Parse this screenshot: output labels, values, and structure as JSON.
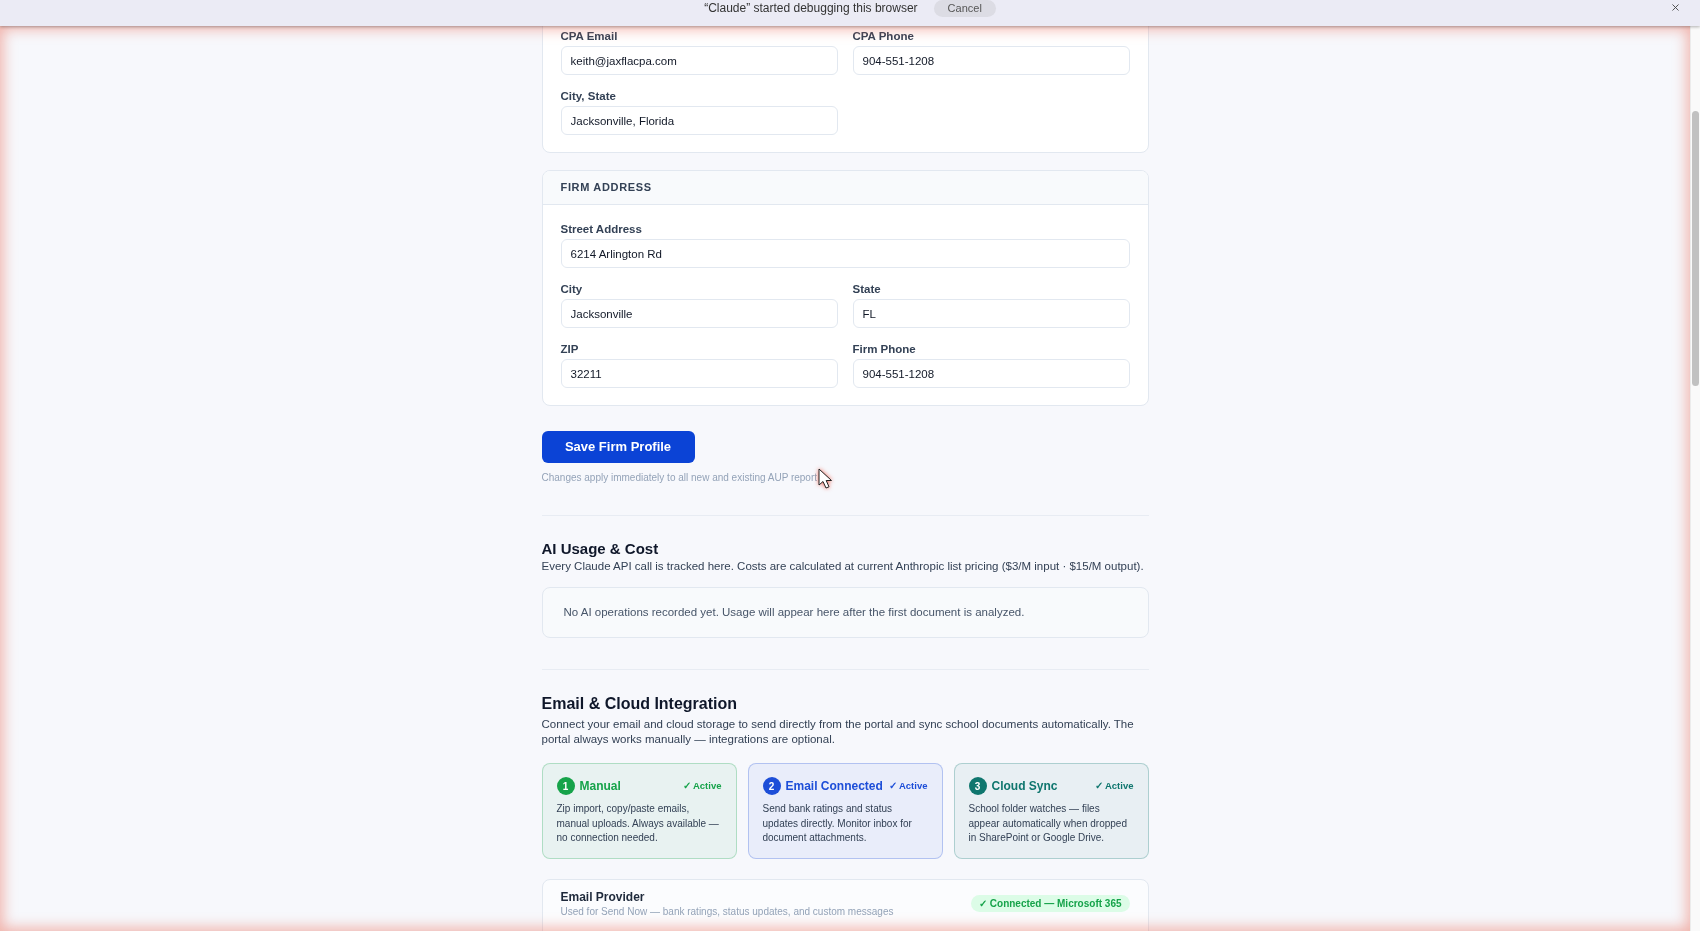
{
  "debug_banner": {
    "message": "“Claude” started debugging this browser",
    "cancel_button": "Cancel"
  },
  "cpa_details": {
    "fields": [
      {
        "label": "CPA Email",
        "value": "keith@jaxflacpa.com"
      },
      {
        "label": "CPA Phone",
        "value": "904-551-1208"
      },
      {
        "label": "City, State",
        "value": "Jacksonville, Florida"
      }
    ]
  },
  "firm_address": {
    "title": "FIRM ADDRESS",
    "street": {
      "label": "Street Address",
      "value": "6214 Arlington Rd"
    },
    "fields": [
      {
        "label": "City",
        "value": "Jacksonville"
      },
      {
        "label": "State",
        "value": "FL"
      },
      {
        "label": "ZIP",
        "value": "32211"
      },
      {
        "label": "Firm Phone",
        "value": "904-551-1208"
      }
    ]
  },
  "save_button": "Save Firm Profile",
  "save_note": "Changes apply immediately to all new and existing AUP report",
  "ai_usage": {
    "title": "AI Usage & Cost",
    "description": "Every Claude API call is tracked here. Costs are calculated at current Anthropic list pricing ($3/M input · $15/M output).",
    "empty_message": "No AI operations recorded yet. Usage will appear here after the first document is analyzed."
  },
  "integration": {
    "title": "Email & Cloud Integration",
    "description": "Connect your email and cloud storage to send directly from the portal and sync school documents automatically. The portal always works manually — integrations are optional.",
    "modes": [
      {
        "number": "1",
        "name": "Manual",
        "status": "✓ Active",
        "description": "Zip import, copy/paste emails, manual uploads. Always available — no connection needed.",
        "color": "#16a34a"
      },
      {
        "number": "2",
        "name": "Email Connected",
        "status": "✓ Active",
        "description": "Send bank ratings and status updates directly. Monitor inbox for document attachments.",
        "color": "#1d4ed8"
      },
      {
        "number": "3",
        "name": "Cloud Sync",
        "status": "✓ Active",
        "description": "School folder watches — files appear automatically when dropped in SharePoint or Google Drive.",
        "color": "#0f766e"
      }
    ],
    "provider": {
      "title": "Email Provider",
      "subtitle": "Used for Send Now — bank ratings, status updates, and custom messages",
      "status": "✓ Connected — Microsoft 365"
    }
  }
}
